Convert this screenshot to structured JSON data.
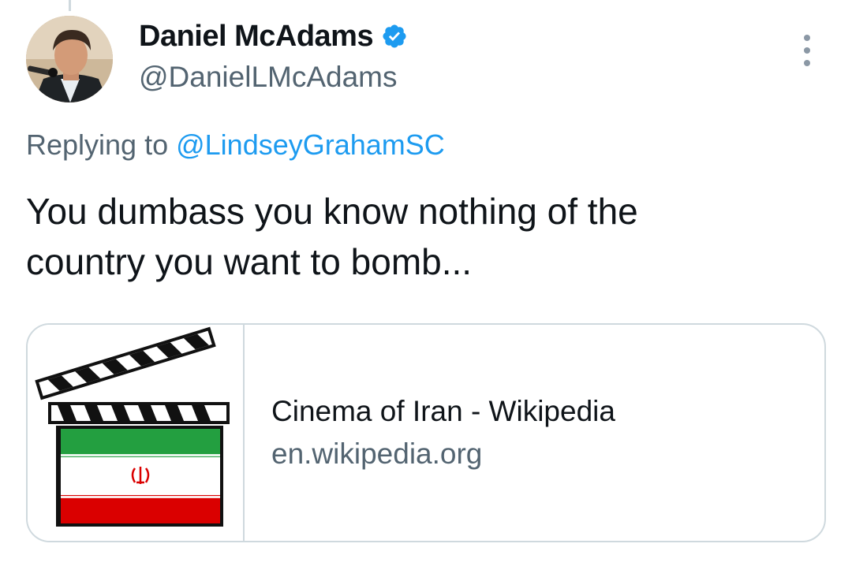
{
  "tweet": {
    "author": {
      "display_name": "Daniel McAdams",
      "handle": "@DanielLMcAdams",
      "verified": true
    },
    "reply": {
      "prefix": "Replying to ",
      "to_handle": "@LindseyGrahamSC"
    },
    "text_line1": "You dumbass you know nothing of the",
    "text_line2": "country you want to bomb..."
  },
  "link_card": {
    "title": "Cinema of Iran - Wikipedia",
    "domain": "en.wikipedia.org",
    "thumbnail_icon": "clapperboard-iran-flag-icon"
  },
  "icons": {
    "verified": "verified-badge-icon",
    "more": "more-options-icon"
  },
  "colors": {
    "accent": "#1d9bf0",
    "text_primary": "#0f1419",
    "text_secondary": "#536471",
    "border": "#cfd9de",
    "flag_green": "#239f40",
    "flag_red": "#da0000"
  }
}
